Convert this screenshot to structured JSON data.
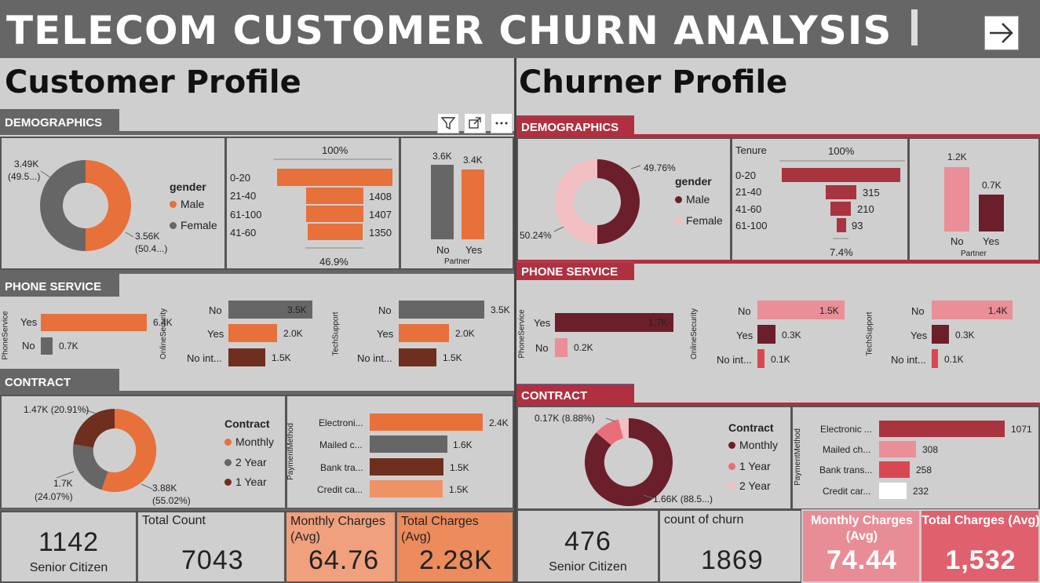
{
  "header": {
    "title": "TELECOM CUSTOMER CHURN ANALYSIS"
  },
  "colors": {
    "orange": "#e8703a",
    "orange_light": "#ef9265",
    "gray": "#666666",
    "brown": "#6e2f1e",
    "maroon": "#6b1f2a",
    "red": "#a8343f",
    "pink": "#ea8e98",
    "pink_light": "#f2bfc3",
    "red_mid": "#d94852"
  },
  "left": {
    "title": "Customer Profile",
    "sections": {
      "demographics": "DEMOGRAPHICS",
      "phone": "PHONE SERVICE",
      "contract": "CONTRACT"
    },
    "gender": {
      "legend_title": "gender",
      "legend": [
        "Male",
        "Female"
      ],
      "female_label_1": "3.49K",
      "female_label_2": "(49.5...)",
      "male_label_1": "3.56K",
      "male_label_2": "(50.4...)"
    },
    "tenure": {
      "top_label": "100%",
      "bottom_label": "46.9%",
      "rows": [
        "0-20",
        "21-40",
        "61-100",
        "41-60"
      ],
      "values": [
        "",
        "1408",
        "1407",
        "1350"
      ]
    },
    "partner": {
      "labels": [
        "No",
        "Yes"
      ],
      "values": [
        "3.6K",
        "3.4K"
      ],
      "axis": "Partner"
    },
    "phone_service": {
      "axis": "PhoneService",
      "rows": [
        "Yes",
        "No"
      ],
      "values": [
        "6.4K",
        "0.7K"
      ]
    },
    "online_security": {
      "axis": "OnlineSecurity",
      "rows": [
        "No",
        "Yes",
        "No int..."
      ],
      "values": [
        "3.5K",
        "2.0K",
        "1.5K"
      ]
    },
    "tech_support": {
      "axis": "TechSupport",
      "rows": [
        "No",
        "Yes",
        "No int..."
      ],
      "values": [
        "3.5K",
        "2.0K",
        "1.5K"
      ]
    },
    "contract": {
      "legend_title": "Contract",
      "legend": [
        "Monthly",
        "2 Year",
        "1 Year"
      ],
      "label_top": "1.47K (20.91%)",
      "label_left_1": "1.7K",
      "label_left_2": "(24.07%)",
      "label_right_1": "3.88K",
      "label_right_2": "(55.02%)"
    },
    "payment": {
      "axis": "PaymentMethod",
      "rows": [
        "Electroni...",
        "Mailed c...",
        "Bank tra...",
        "Credit ca..."
      ],
      "values": [
        "2.4K",
        "1.6K",
        "1.5K",
        "1.5K"
      ]
    },
    "kpis": {
      "senior_value": "1142",
      "senior_label": "Senior Citizen",
      "total_count_title": "Total Count",
      "total_count_value": "7043",
      "monthly_title": "Monthly Charges (Avg)",
      "monthly_value": "64.76",
      "total_charges_title": "Total Charges (Avg)",
      "total_charges_value": "2.28K"
    }
  },
  "right": {
    "title": "Churner Profile",
    "sections": {
      "demographics": "DEMOGRAPHICS",
      "phone": "PHONE SERVICE",
      "contract": "CONTRACT"
    },
    "gender": {
      "legend_title": "gender",
      "legend": [
        "Male",
        "Female"
      ],
      "male_label": "49.76%",
      "female_label": "50.24%"
    },
    "tenure": {
      "title": "Tenure",
      "top_label": "100%",
      "bottom_label": "7.4%",
      "rows": [
        "0-20",
        "21-40",
        "41-60",
        "61-100"
      ],
      "values": [
        "",
        "315",
        "210",
        "93"
      ]
    },
    "partner": {
      "labels": [
        "No",
        "Yes"
      ],
      "values": [
        "1.2K",
        "0.7K"
      ],
      "axis": "Partner"
    },
    "phone_service": {
      "axis": "PhoneService",
      "rows": [
        "Yes",
        "No"
      ],
      "values": [
        "1.7K",
        "0.2K"
      ]
    },
    "online_security": {
      "axis": "OnlineSecurity",
      "rows": [
        "No",
        "Yes",
        "No int..."
      ],
      "values": [
        "1.5K",
        "0.3K",
        "0.1K"
      ]
    },
    "tech_support": {
      "axis": "TechSupport",
      "rows": [
        "No",
        "Yes",
        "No int..."
      ],
      "values": [
        "1.4K",
        "0.3K",
        "0.1K"
      ]
    },
    "contract": {
      "legend_title": "Contract",
      "legend": [
        "Monthly",
        "1 Year",
        "2 Year"
      ],
      "label_top": "0.17K (8.88%)",
      "label_bottom": "1.66K (88.5...)"
    },
    "payment": {
      "axis": "PaymentMethod",
      "rows": [
        "Electronic ...",
        "Mailed ch...",
        "Bank trans...",
        "Credit car..."
      ],
      "values": [
        "1071",
        "308",
        "258",
        "232"
      ]
    },
    "kpis": {
      "senior_value": "476",
      "senior_label": "Senior Citizen",
      "churn_title": "count of churn",
      "churn_value": "1869",
      "monthly_title": "Monthly Charges (Avg)",
      "monthly_value": "74.44",
      "total_charges_title": "Total Charges (Avg)",
      "total_charges_value": "1,532"
    }
  }
}
